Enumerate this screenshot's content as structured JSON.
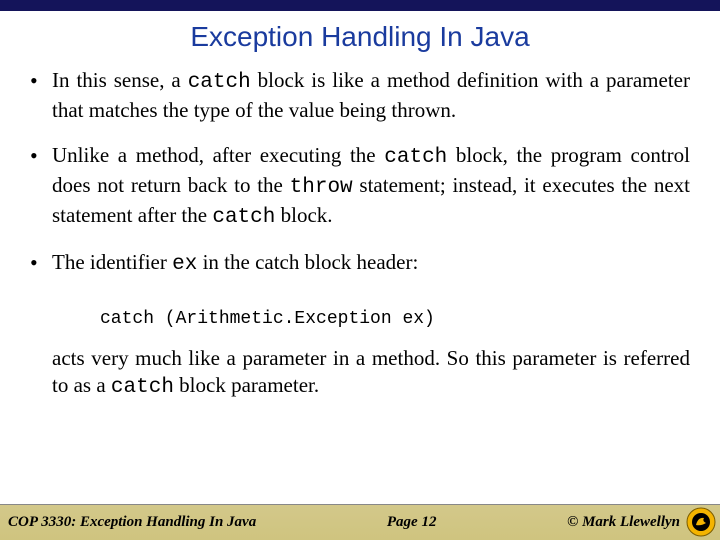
{
  "title": "Exception Handling In Java",
  "bullets": [
    {
      "segments": [
        {
          "text": "In this sense, a ",
          "code": false
        },
        {
          "text": "catch",
          "code": true
        },
        {
          "text": " block is like a method definition with a parameter that matches the type of the value being thrown.",
          "code": false
        }
      ]
    },
    {
      "segments": [
        {
          "text": "Unlike a method, after executing the ",
          "code": false
        },
        {
          "text": "catch",
          "code": true
        },
        {
          "text": " block, the program control does not return back to the ",
          "code": false
        },
        {
          "text": "throw",
          "code": true
        },
        {
          "text": " statement; instead, it executes the next statement after the ",
          "code": false
        },
        {
          "text": "catch",
          "code": true
        },
        {
          "text": " block.",
          "code": false
        }
      ]
    },
    {
      "segments": [
        {
          "text": "The identifier ",
          "code": false
        },
        {
          "text": "ex",
          "code": true
        },
        {
          "text": "  in the catch block header:",
          "code": false
        }
      ]
    }
  ],
  "code_line": "catch (Arithmetic.Exception ex)",
  "after_code_segments": [
    {
      "text": "acts very much like a parameter in a method.  So this parameter is referred to as a ",
      "code": false
    },
    {
      "text": "catch",
      "code": true
    },
    {
      "text": " block parameter.",
      "code": false
    }
  ],
  "footer": {
    "left": "COP 3330:  Exception Handling In Java",
    "center": "Page 12",
    "right": "© Mark Llewellyn"
  }
}
